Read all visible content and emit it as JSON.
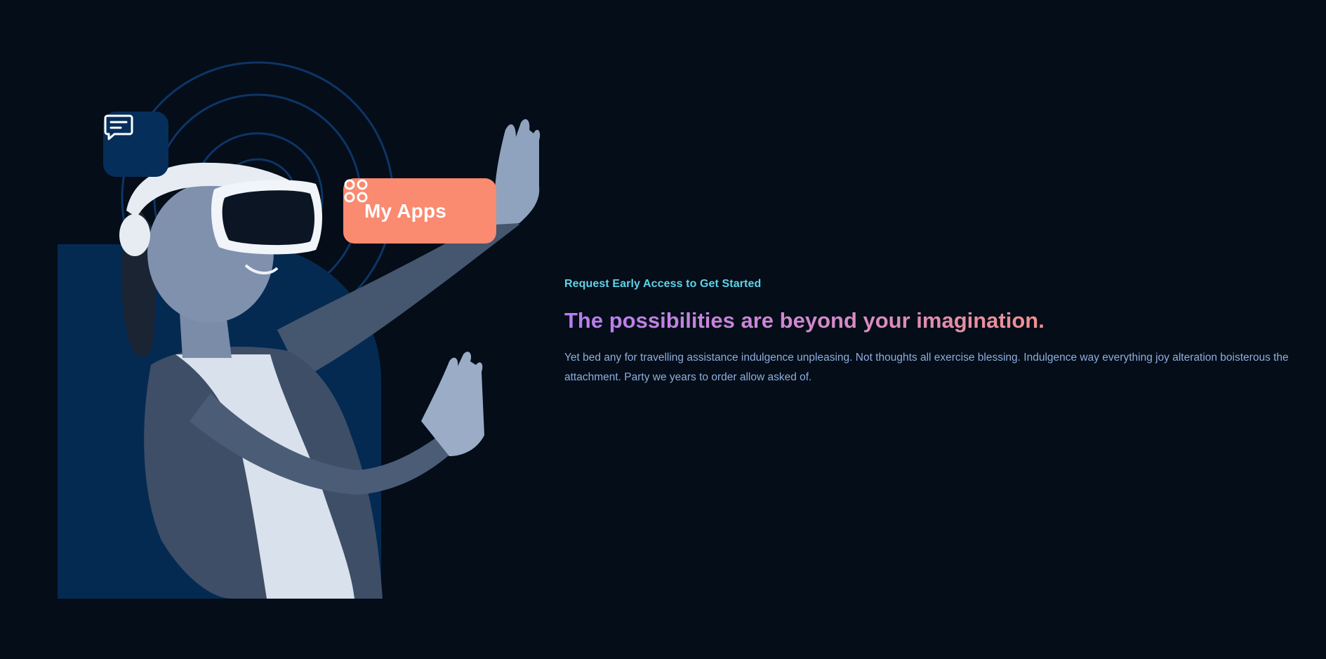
{
  "hero": {
    "chat_icon": "chat-bubble-icon",
    "apps_icon": "grid-icon",
    "apps_label": "My Apps"
  },
  "content": {
    "eyebrow": "Request Early Access to Get Started",
    "headline": "The possibilities are beyond your imagination.",
    "body": "Yet bed any for travelling assistance indulgence unpleasing. Not thoughts all exercise blessing. Indulgence way everything joy alteration boisterous the attachment. Party we years to order allow asked of."
  },
  "colors": {
    "background": "#040d18",
    "panel": "#062e5a",
    "accent_pill": "#fa8a70",
    "eyebrow": "#5fd3e8",
    "body_text": "#8eaedd",
    "headline_gradient_start": "#b67df0",
    "headline_gradient_end": "#f0918d"
  }
}
